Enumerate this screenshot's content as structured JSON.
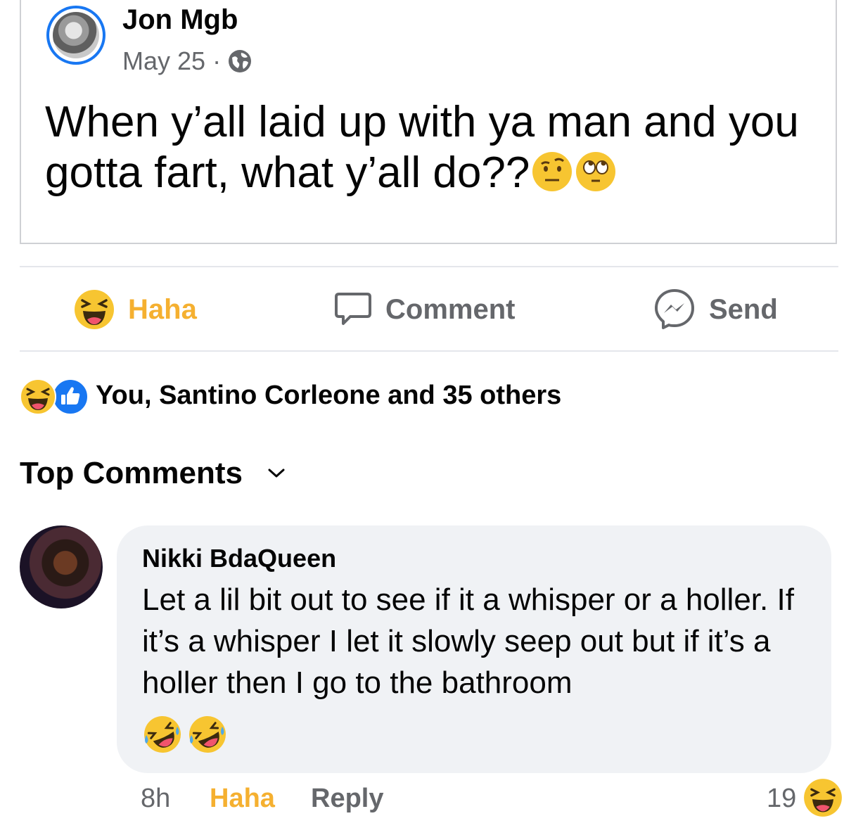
{
  "post": {
    "author": "Jon Mgb",
    "date": "May 25",
    "separator": "·",
    "text": "When y’all laid up with ya man and you gotta fart, what y’all do??"
  },
  "actions": {
    "haha": "Haha",
    "comment": "Comment",
    "send": "Send"
  },
  "reactions": {
    "summary": "You, Santino Corleone and 35 others"
  },
  "comments_header": {
    "label": "Top Comments"
  },
  "comment": {
    "author": "Nikki BdaQueen",
    "text": "Let a lil bit out to see if it a whisper or a holler. If it’s a whisper I let it slowly seep out but if it’s a holler then I go to the bathroom",
    "time": "8h",
    "reaction_label": "Haha",
    "reply_label": "Reply",
    "reaction_count": "19"
  },
  "colors": {
    "haha_accent": "#f5b030",
    "secondary_text": "#65676b",
    "like_blue": "#1877f2",
    "bubble_bg": "#f0f2f5"
  },
  "icons": [
    "globe-icon",
    "raised-eyebrow-emoji",
    "eye-roll-emoji",
    "haha-icon",
    "comment-icon",
    "messenger-icon",
    "like-icon",
    "chevron-down-icon",
    "rofl-emoji"
  ]
}
